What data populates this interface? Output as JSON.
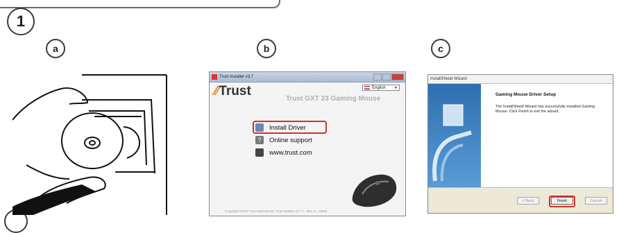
{
  "step": {
    "number": "1"
  },
  "panels": {
    "a": {
      "label": "a"
    },
    "b": {
      "label": "b"
    },
    "c": {
      "label": "c"
    }
  },
  "installer": {
    "title": "Trust Installer v3.7",
    "language": "English",
    "brand": "Trust",
    "product": "Trust GXT 23 Gaming Mouse",
    "menu": [
      "Install Driver",
      "Online support",
      "www.trust.com"
    ],
    "highlighted_item": "Install Driver",
    "copyright": "Copyright ©2011 Trust International. Trust Installer v3.7.1 - item no. 19284",
    "highlight_color": "#d0302a"
  },
  "wizard": {
    "title": "InstallShield Wizard",
    "heading": "Gaming Mouse Driver Setup",
    "body": "The InstallShield Wizard has successfully installed Gaming Mouse. Click Finish to exit the wizard.",
    "buttons": {
      "back": "< Back",
      "finish": "Finish",
      "cancel": "Cancel"
    }
  }
}
